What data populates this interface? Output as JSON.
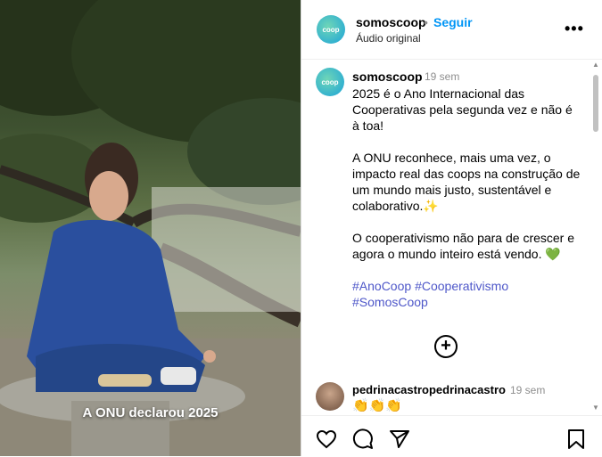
{
  "media": {
    "overlay_caption": "A ONU declarou 2025"
  },
  "header": {
    "username": "somoscoop",
    "separator": "•",
    "follow_label": "Seguir",
    "audio_label": "Áudio original",
    "avatar_text": "coop",
    "more_icon": "more-horizontal-icon"
  },
  "caption": {
    "username": "somoscoop",
    "time": "19 sem",
    "paragraph1": "2025 é o Ano Internacional das Cooperativas pela segunda vez e não é à toa!",
    "paragraph2": "A ONU reconhece, mais uma vez, o impacto real das coops na construção de um mundo mais justo, sustentável e colaborativo.✨",
    "paragraph3": "O cooperativismo não para de crescer e agora o mundo inteiro está vendo. 💚",
    "hashtag1": "#AnoCoop",
    "hashtag2": "#Cooperativismo",
    "hashtag3": "#SomosCoop"
  },
  "load_more_icon": "plus-circle-icon",
  "reply": {
    "username": "pedrinacastropedrinacastro",
    "time": "19 sem",
    "text": "👏👏👏"
  },
  "actions": {
    "like_icon": "heart-icon",
    "comment_icon": "comment-icon",
    "share_icon": "share-icon",
    "save_icon": "bookmark-icon"
  }
}
